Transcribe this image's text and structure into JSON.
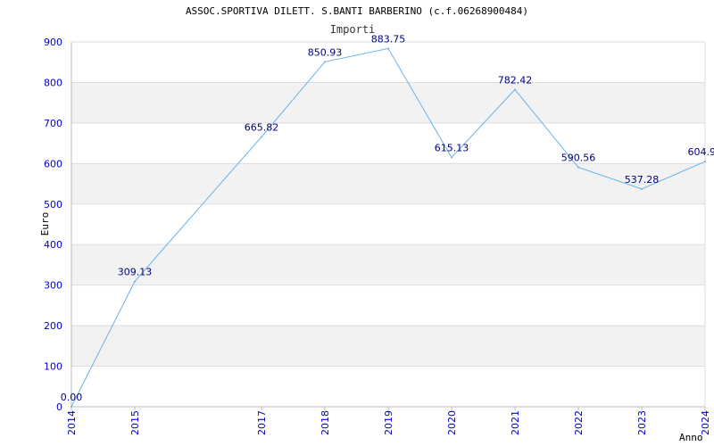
{
  "chart_data": {
    "type": "line",
    "title": "ASSOC.SPORTIVA DILETT. S.BANTI BARBERINO (c.f.06268900484)",
    "series": [
      {
        "name": "Importi",
        "x": [
          "2014",
          "2015",
          "2017",
          "2018",
          "2019",
          "2020",
          "2021",
          "2022",
          "2023",
          "2024"
        ],
        "values": [
          0.0,
          309.13,
          665.82,
          850.93,
          883.75,
          615.13,
          782.42,
          590.56,
          537.28,
          604.9
        ],
        "value_labels": [
          "0.00",
          "309.13",
          "665.82",
          "850.93",
          "883.75",
          "615.13",
          "782.42",
          "590.56",
          "537.28",
          "604.9"
        ],
        "color": "#6ab0e8"
      }
    ],
    "xlabel": "Anno",
    "ylabel": "Euro",
    "ylim": [
      0,
      900
    ],
    "yticks": [
      "0",
      "100",
      "200",
      "300",
      "400",
      "500",
      "600",
      "700",
      "800",
      "900"
    ],
    "grid": true,
    "band_color": "#f2f2f2",
    "tick_color": "#0000cc",
    "data_label_color": "#000080"
  }
}
